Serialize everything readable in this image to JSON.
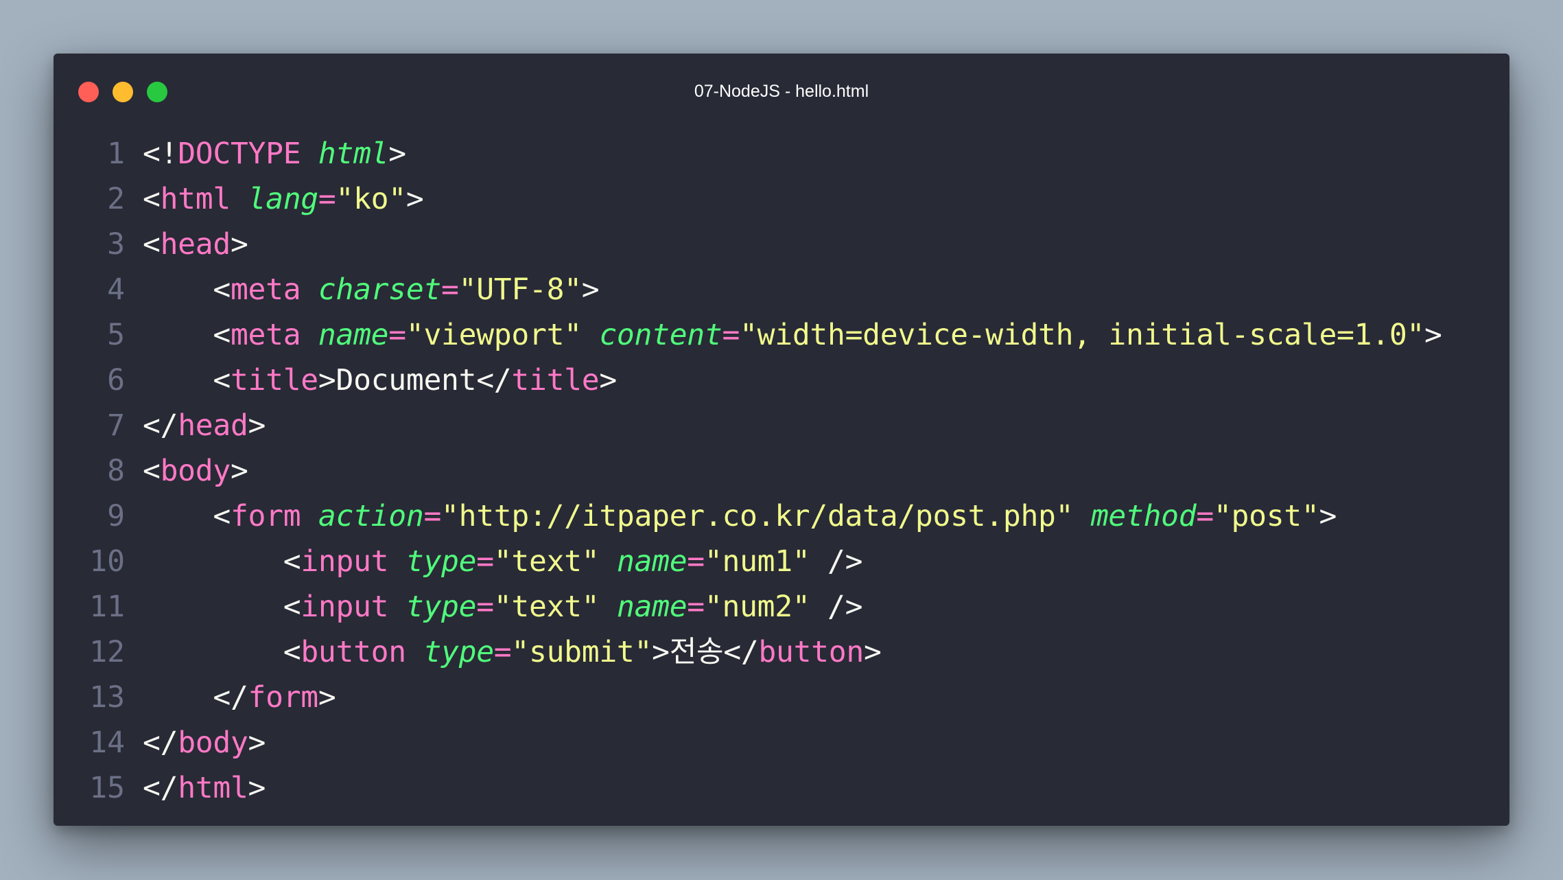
{
  "window": {
    "title": "07-NodeJS - hello.html",
    "controls": [
      "close",
      "minimize",
      "zoom"
    ]
  },
  "colors": {
    "background": "#a3b1bf",
    "editor": "#282a36",
    "tag": "#ff79c6",
    "attribute": "#50fa7b",
    "string": "#f1fa8c",
    "text": "#f8f8f2",
    "line_number": "#6c7086"
  },
  "lines": [
    {
      "num": "1",
      "tokens": [
        [
          "punct",
          "<!"
        ],
        [
          "doctype",
          "DOCTYPE"
        ],
        [
          "text",
          " "
        ],
        [
          "attr",
          "html"
        ],
        [
          "punct",
          ">"
        ]
      ]
    },
    {
      "num": "2",
      "tokens": [
        [
          "punct",
          "<"
        ],
        [
          "tag",
          "html"
        ],
        [
          "text",
          " "
        ],
        [
          "attr",
          "lang"
        ],
        [
          "op",
          "="
        ],
        [
          "str",
          "\"ko\""
        ],
        [
          "punct",
          ">"
        ]
      ]
    },
    {
      "num": "3",
      "tokens": [
        [
          "punct",
          "<"
        ],
        [
          "tag",
          "head"
        ],
        [
          "punct",
          ">"
        ]
      ]
    },
    {
      "num": "4",
      "tokens": [
        [
          "text",
          "    "
        ],
        [
          "punct",
          "<"
        ],
        [
          "tag",
          "meta"
        ],
        [
          "text",
          " "
        ],
        [
          "attr",
          "charset"
        ],
        [
          "op",
          "="
        ],
        [
          "str",
          "\"UTF-8\""
        ],
        [
          "punct",
          ">"
        ]
      ]
    },
    {
      "num": "5",
      "tokens": [
        [
          "text",
          "    "
        ],
        [
          "punct",
          "<"
        ],
        [
          "tag",
          "meta"
        ],
        [
          "text",
          " "
        ],
        [
          "attr",
          "name"
        ],
        [
          "op",
          "="
        ],
        [
          "str",
          "\"viewport\""
        ],
        [
          "text",
          " "
        ],
        [
          "attr",
          "content"
        ],
        [
          "op",
          "="
        ],
        [
          "str",
          "\"width=device-width, initial-scale=1.0\""
        ],
        [
          "punct",
          ">"
        ]
      ]
    },
    {
      "num": "6",
      "tokens": [
        [
          "text",
          "    "
        ],
        [
          "punct",
          "<"
        ],
        [
          "tag",
          "title"
        ],
        [
          "punct",
          ">"
        ],
        [
          "text",
          "Document"
        ],
        [
          "punct",
          "</"
        ],
        [
          "tag",
          "title"
        ],
        [
          "punct",
          ">"
        ]
      ]
    },
    {
      "num": "7",
      "tokens": [
        [
          "punct",
          "</"
        ],
        [
          "tag",
          "head"
        ],
        [
          "punct",
          ">"
        ]
      ]
    },
    {
      "num": "8",
      "tokens": [
        [
          "punct",
          "<"
        ],
        [
          "tag",
          "body"
        ],
        [
          "punct",
          ">"
        ]
      ]
    },
    {
      "num": "9",
      "tokens": [
        [
          "text",
          "    "
        ],
        [
          "punct",
          "<"
        ],
        [
          "tag",
          "form"
        ],
        [
          "text",
          " "
        ],
        [
          "attr",
          "action"
        ],
        [
          "op",
          "="
        ],
        [
          "str",
          "\"http://itpaper.co.kr/data/post.php\""
        ],
        [
          "text",
          " "
        ],
        [
          "attr",
          "method"
        ],
        [
          "op",
          "="
        ],
        [
          "str",
          "\"post\""
        ],
        [
          "punct",
          ">"
        ]
      ]
    },
    {
      "num": "10",
      "tokens": [
        [
          "text",
          "        "
        ],
        [
          "punct",
          "<"
        ],
        [
          "tag",
          "input"
        ],
        [
          "text",
          " "
        ],
        [
          "attr",
          "type"
        ],
        [
          "op",
          "="
        ],
        [
          "str",
          "\"text\""
        ],
        [
          "text",
          " "
        ],
        [
          "attr",
          "name"
        ],
        [
          "op",
          "="
        ],
        [
          "str",
          "\"num1\""
        ],
        [
          "text",
          " "
        ],
        [
          "punct",
          "/>"
        ]
      ]
    },
    {
      "num": "11",
      "tokens": [
        [
          "text",
          "        "
        ],
        [
          "punct",
          "<"
        ],
        [
          "tag",
          "input"
        ],
        [
          "text",
          " "
        ],
        [
          "attr",
          "type"
        ],
        [
          "op",
          "="
        ],
        [
          "str",
          "\"text\""
        ],
        [
          "text",
          " "
        ],
        [
          "attr",
          "name"
        ],
        [
          "op",
          "="
        ],
        [
          "str",
          "\"num2\""
        ],
        [
          "text",
          " "
        ],
        [
          "punct",
          "/>"
        ]
      ]
    },
    {
      "num": "12",
      "tokens": [
        [
          "text",
          "        "
        ],
        [
          "punct",
          "<"
        ],
        [
          "tag",
          "button"
        ],
        [
          "text",
          " "
        ],
        [
          "attr",
          "type"
        ],
        [
          "op",
          "="
        ],
        [
          "str",
          "\"submit\""
        ],
        [
          "punct",
          ">"
        ],
        [
          "text",
          "전송"
        ],
        [
          "punct",
          "</"
        ],
        [
          "tag",
          "button"
        ],
        [
          "punct",
          ">"
        ]
      ]
    },
    {
      "num": "13",
      "tokens": [
        [
          "text",
          "    "
        ],
        [
          "punct",
          "</"
        ],
        [
          "tag",
          "form"
        ],
        [
          "punct",
          ">"
        ]
      ]
    },
    {
      "num": "14",
      "tokens": [
        [
          "punct",
          "</"
        ],
        [
          "tag",
          "body"
        ],
        [
          "punct",
          ">"
        ]
      ]
    },
    {
      "num": "15",
      "tokens": [
        [
          "punct",
          "</"
        ],
        [
          "tag",
          "html"
        ],
        [
          "punct",
          ">"
        ]
      ]
    }
  ]
}
